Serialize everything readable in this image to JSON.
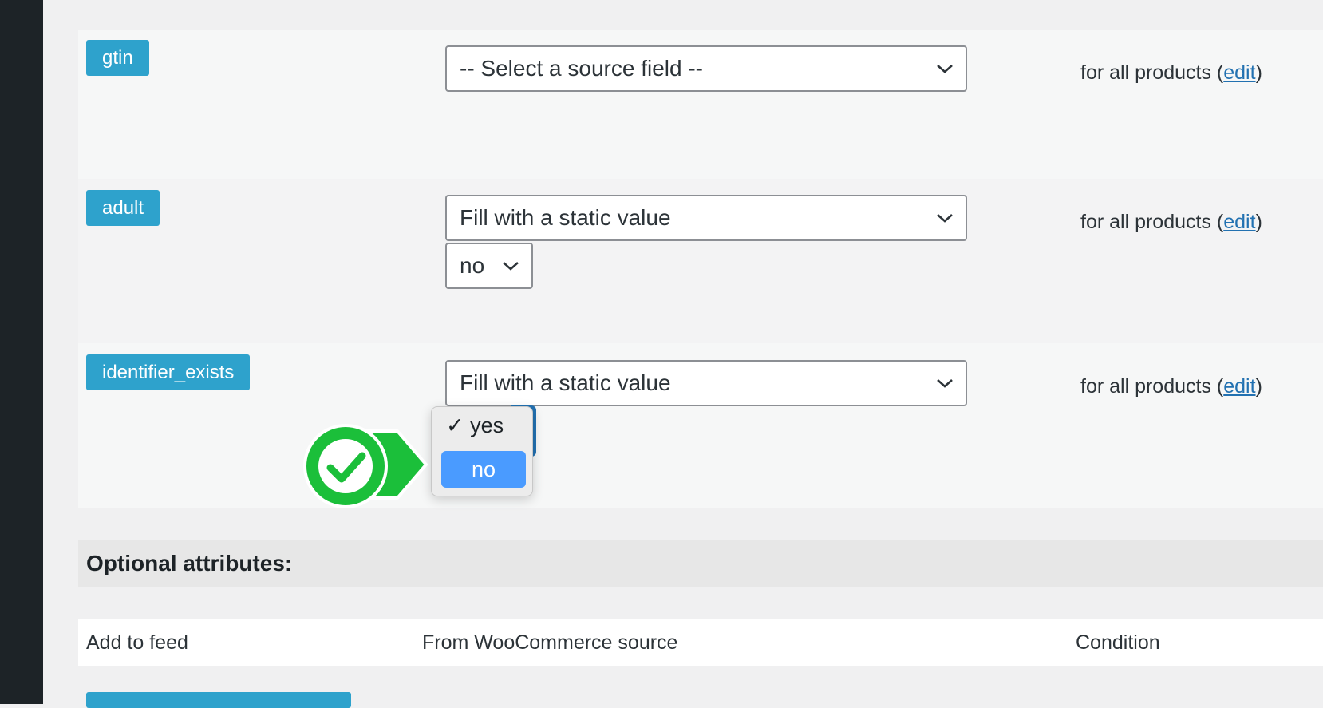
{
  "required_rows": [
    {
      "attribute": "gtin",
      "source_select": "-- Select a source field --",
      "condition_text": "for all products (",
      "condition_link": "edit",
      "condition_close": ")"
    },
    {
      "attribute": "adult",
      "source_select": "Fill with a static value",
      "static_value": "no",
      "condition_text": "for all products (",
      "condition_link": "edit",
      "condition_close": ")"
    },
    {
      "attribute": "identifier_exists",
      "source_select": "Fill with a static value",
      "condition_text": "for all products (",
      "condition_link": "edit",
      "condition_close": ")"
    }
  ],
  "dropdown": {
    "options": [
      {
        "label": "yes",
        "checked_mark": "✓"
      },
      {
        "label": "no"
      }
    ],
    "highlighted": "no"
  },
  "optional": {
    "heading": "Optional attributes:",
    "columns": [
      "Add to feed",
      "From WooCommerce source",
      "Condition"
    ]
  },
  "colors": {
    "tag_blue": "#2ea2cc",
    "link_blue": "#2271b1",
    "highlight_blue": "#4a9bff",
    "callout_green": "#1bbf3a"
  }
}
